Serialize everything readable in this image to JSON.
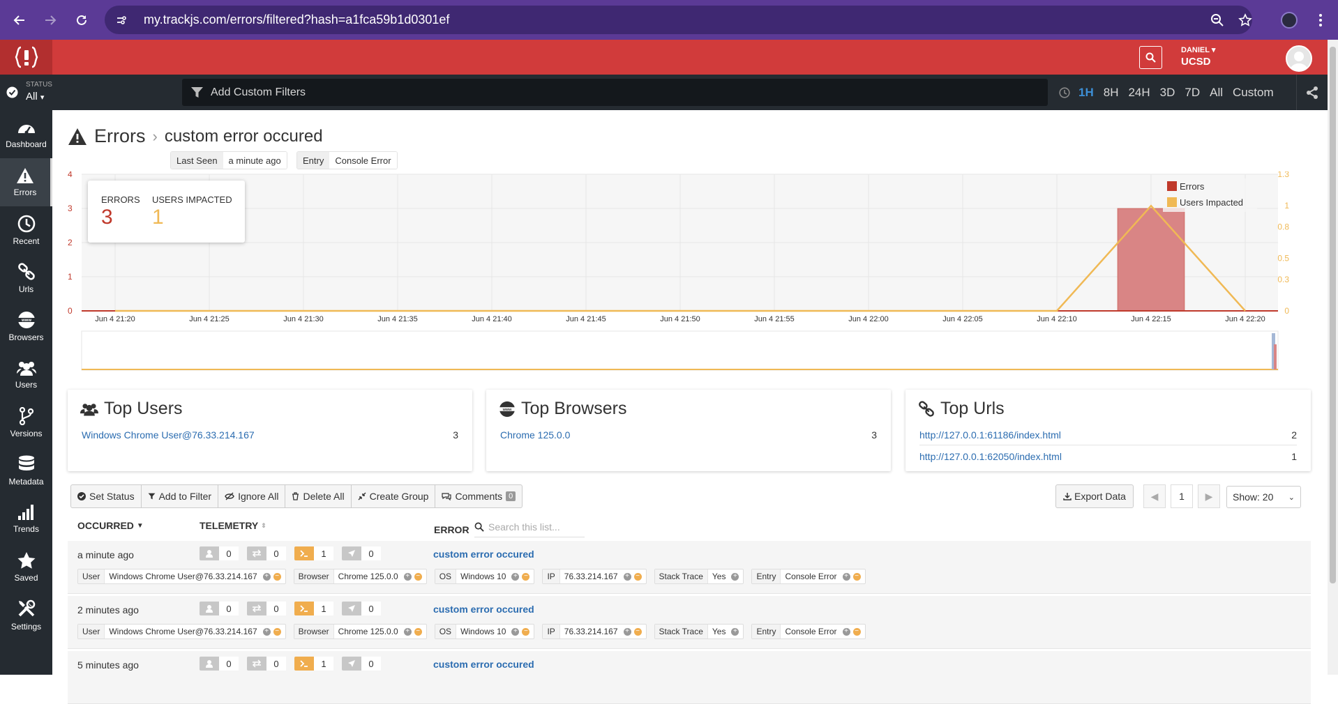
{
  "browser": {
    "url": "my.trackjs.com/errors/filtered?hash=a1fca59b1d0301ef"
  },
  "header": {
    "user_name": "DANIEL",
    "org": "UCSD"
  },
  "filterbar": {
    "status_label": "STATUS",
    "status_value": "All",
    "filter_placeholder": "Add Custom Filters",
    "ranges": [
      "1H",
      "8H",
      "24H",
      "3D",
      "7D",
      "All",
      "Custom"
    ],
    "active_range": "1H"
  },
  "sidebar": {
    "items": [
      {
        "label": "Dashboard",
        "icon": "dashboard-icon"
      },
      {
        "label": "Errors",
        "icon": "warning-icon",
        "active": true
      },
      {
        "label": "Recent",
        "icon": "clock-icon"
      },
      {
        "label": "Urls",
        "icon": "link-icon"
      },
      {
        "label": "Browsers",
        "icon": "www-icon"
      },
      {
        "label": "Users",
        "icon": "users-icon"
      },
      {
        "label": "Versions",
        "icon": "branch-icon"
      },
      {
        "label": "Metadata",
        "icon": "database-icon"
      },
      {
        "label": "Trends",
        "icon": "bar-chart-icon"
      },
      {
        "label": "Saved",
        "icon": "star-icon"
      },
      {
        "label": "Settings",
        "icon": "tools-icon"
      }
    ]
  },
  "page": {
    "section": "Errors",
    "title": "custom error occured",
    "last_seen_label": "Last Seen",
    "last_seen_value": "a minute ago",
    "entry_label": "Entry",
    "entry_value": "Console Error"
  },
  "stats": {
    "errors_label": "ERRORS",
    "errors_value": "3",
    "users_label": "USERS IMPACTED",
    "users_value": "1"
  },
  "chart_data": {
    "type": "bar",
    "x": [
      "Jun 4 21:20",
      "Jun 4 21:25",
      "Jun 4 21:30",
      "Jun 4 21:35",
      "Jun 4 21:40",
      "Jun 4 21:45",
      "Jun 4 21:50",
      "Jun 4 21:55",
      "Jun 4 22:00",
      "Jun 4 22:05",
      "Jun 4 22:10",
      "Jun 4 22:15",
      "Jun 4 22:20"
    ],
    "series": [
      {
        "name": "Errors",
        "type": "bar",
        "axis": "left",
        "values": [
          0,
          0,
          0,
          0,
          0,
          0,
          0,
          0,
          0,
          0,
          0,
          3,
          0
        ],
        "color": "#c0392b"
      },
      {
        "name": "Users Impacted",
        "type": "line",
        "axis": "right",
        "values": [
          0,
          0,
          0,
          0,
          0,
          0,
          0,
          0,
          0,
          0,
          0,
          1,
          0
        ],
        "color": "#f0b955"
      }
    ],
    "y_left_ticks": [
      "0",
      "1",
      "2",
      "3",
      "4"
    ],
    "y_right_ticks": [
      "0",
      "0.3",
      "0.5",
      "0.8",
      "1",
      "1.3"
    ],
    "ylim_left": [
      0,
      4
    ],
    "ylim_right": [
      0,
      1.3
    ],
    "legend_position": "top-right",
    "grid": true
  },
  "cards": {
    "users": {
      "title": "Top Users",
      "rows": [
        {
          "label": "Windows Chrome User@76.33.214.167",
          "count": "3"
        }
      ]
    },
    "browsers": {
      "title": "Top Browsers",
      "rows": [
        {
          "label": "Chrome 125.0.0",
          "count": "3"
        }
      ]
    },
    "urls": {
      "title": "Top Urls",
      "rows": [
        {
          "label": "http://127.0.0.1:61186/index.html",
          "count": "2"
        },
        {
          "label": "http://127.0.0.1:62050/index.html",
          "count": "1"
        }
      ]
    }
  },
  "toolbar": {
    "set_status": "Set Status",
    "add_filter": "Add to Filter",
    "ignore_all": "Ignore All",
    "delete_all": "Delete All",
    "create_group": "Create Group",
    "comments": "Comments",
    "comments_count": "0",
    "export": "Export Data",
    "page": "1",
    "show": "Show: 20"
  },
  "list": {
    "col_occurred": "OCCURRED",
    "col_telemetry": "TELEMETRY",
    "col_error": "ERROR",
    "search_placeholder": "Search this list...",
    "rows": [
      {
        "when": "a minute ago",
        "tel": [
          "0",
          "0",
          "1",
          "0"
        ],
        "msg": "custom error occured",
        "meta": true
      },
      {
        "when": "2 minutes ago",
        "tel": [
          "0",
          "0",
          "1",
          "0"
        ],
        "msg": "custom error occured",
        "meta": true
      },
      {
        "when": "5 minutes ago",
        "tel": [
          "0",
          "0",
          "1",
          "0"
        ],
        "msg": "custom error occured",
        "meta": false
      }
    ],
    "meta": {
      "user_k": "User",
      "user_v": "Windows Chrome User@76.33.214.167",
      "browser_k": "Browser",
      "browser_v": "Chrome 125.0.0",
      "os_k": "OS",
      "os_v": "Windows 10",
      "ip_k": "IP",
      "ip_v": "76.33.214.167",
      "st_k": "Stack Trace",
      "st_v": "Yes",
      "entry_k": "Entry",
      "entry_v": "Console Error"
    }
  }
}
